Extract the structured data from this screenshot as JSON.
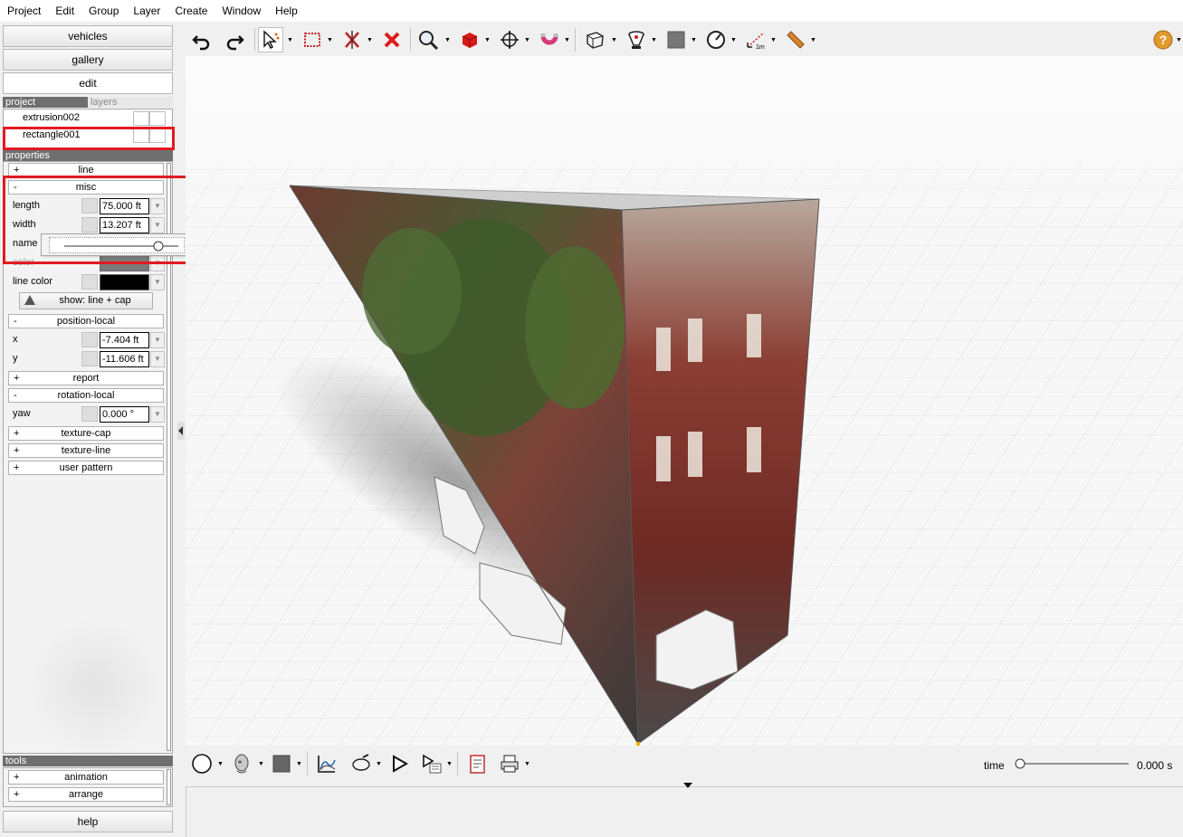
{
  "menu": [
    "Project",
    "Edit",
    "Group",
    "Layer",
    "Create",
    "Window",
    "Help"
  ],
  "nav": {
    "vehicles": "vehicles",
    "gallery": "gallery",
    "edit": "edit"
  },
  "panel_tabs": {
    "project": "project",
    "layers": "layers"
  },
  "objects": [
    "extrusion002",
    "rectangle001"
  ],
  "properties_header": "properties",
  "sections": {
    "line": {
      "toggle": "+",
      "label": "line"
    },
    "misc": {
      "toggle": "-",
      "label": "misc"
    },
    "position": {
      "toggle": "-",
      "label": "position-local"
    },
    "report": {
      "toggle": "+",
      "label": "report"
    },
    "rotation": {
      "toggle": "-",
      "label": "rotation-local"
    },
    "texture_cap": {
      "toggle": "+",
      "label": "texture-cap"
    },
    "texture_line": {
      "toggle": "+",
      "label": "texture-line"
    },
    "user_pattern": {
      "toggle": "+",
      "label": "user pattern"
    }
  },
  "props": {
    "length": {
      "label": "length",
      "value": "75.000 ft"
    },
    "width": {
      "label": "width",
      "value": "13.207 ft"
    },
    "name": {
      "label": "name"
    },
    "color": {
      "label": "color"
    },
    "line_color": {
      "label": "line color"
    },
    "show_button": "show: line + cap",
    "x": {
      "label": "x",
      "value": "-7.404 ft"
    },
    "y": {
      "label": "y",
      "value": "-11.606 ft"
    },
    "yaw": {
      "label": "yaw",
      "value": "0.000 °"
    }
  },
  "tools_header": "tools",
  "tools": {
    "animation": {
      "toggle": "+",
      "label": "animation"
    },
    "arrange": {
      "toggle": "+",
      "label": "arrange"
    }
  },
  "help_button": "help",
  "time": {
    "label": "time",
    "value": "0.000 s",
    "slider": 0
  },
  "colors": {
    "highlight": "#e21a22",
    "header": "#6f6f6f",
    "fill_gray": "#7a7a7a",
    "line_color": "#000000"
  },
  "icons": {
    "toolbar": [
      "undo-icon",
      "redo-icon",
      "select-arrow-icon",
      "selection-rect-icon",
      "cut-icon",
      "delete-icon",
      "zoom-icon",
      "red-cube-icon",
      "move-icon",
      "magnet-icon",
      "view-cube-icon",
      "camera-icon",
      "square-icon",
      "gauge-icon",
      "measure-icon",
      "ruler-icon",
      "help-icon"
    ],
    "bottom": [
      "circle-icon",
      "head-icon",
      "square-fill-icon",
      "graph-icon",
      "tools-icon",
      "play-icon",
      "sequence-icon",
      "report-icon",
      "print-icon"
    ]
  }
}
